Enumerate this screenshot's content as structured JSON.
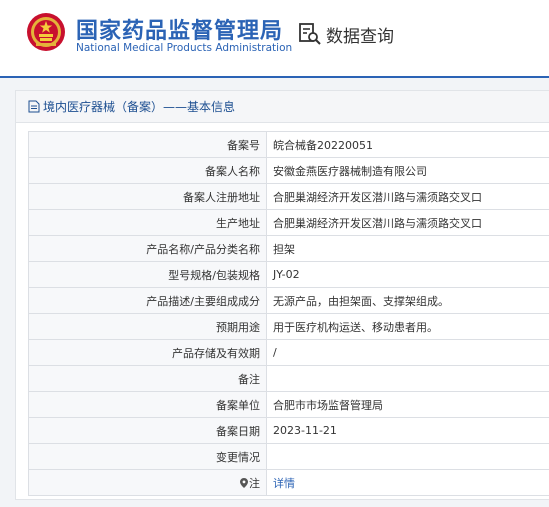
{
  "header": {
    "title_cn": "国家药品监督管理局",
    "title_en": "National Medical Products Administration",
    "query_label": "数据查询",
    "brand_color": "#2b63b5",
    "emblem_icon": "national-emblem"
  },
  "breadcrumb": {
    "text": "境内医疗器械（备案）——基本信息",
    "icon": "document-icon"
  },
  "rows": [
    {
      "label": "备案号",
      "value": "皖合械备20220051"
    },
    {
      "label": "备案人名称",
      "value": "安徽金燕医疗器械制造有限公司"
    },
    {
      "label": "备案人注册地址",
      "value": "合肥巢湖经济开发区潜川路与濡须路交叉口"
    },
    {
      "label": "生产地址",
      "value": "合肥巢湖经济开发区潜川路与濡须路交叉口"
    },
    {
      "label": "产品名称/产品分类名称",
      "value": "担架"
    },
    {
      "label": "型号规格/包装规格",
      "value": "JY-02"
    },
    {
      "label": "产品描述/主要组成成分",
      "value": "无源产品，由担架面、支撑架组成。"
    },
    {
      "label": "预期用途",
      "value": "用于医疗机构运送、移动患者用。"
    },
    {
      "label": "产品存储及有效期",
      "value": "/"
    },
    {
      "label": "备注",
      "value": ""
    },
    {
      "label": "备案单位",
      "value": "合肥市市场监督管理局"
    },
    {
      "label": "备案日期",
      "value": "2023-11-21"
    },
    {
      "label": "变更情况",
      "value": ""
    },
    {
      "label": "注",
      "value": "详情",
      "icon": "pin-icon"
    }
  ]
}
